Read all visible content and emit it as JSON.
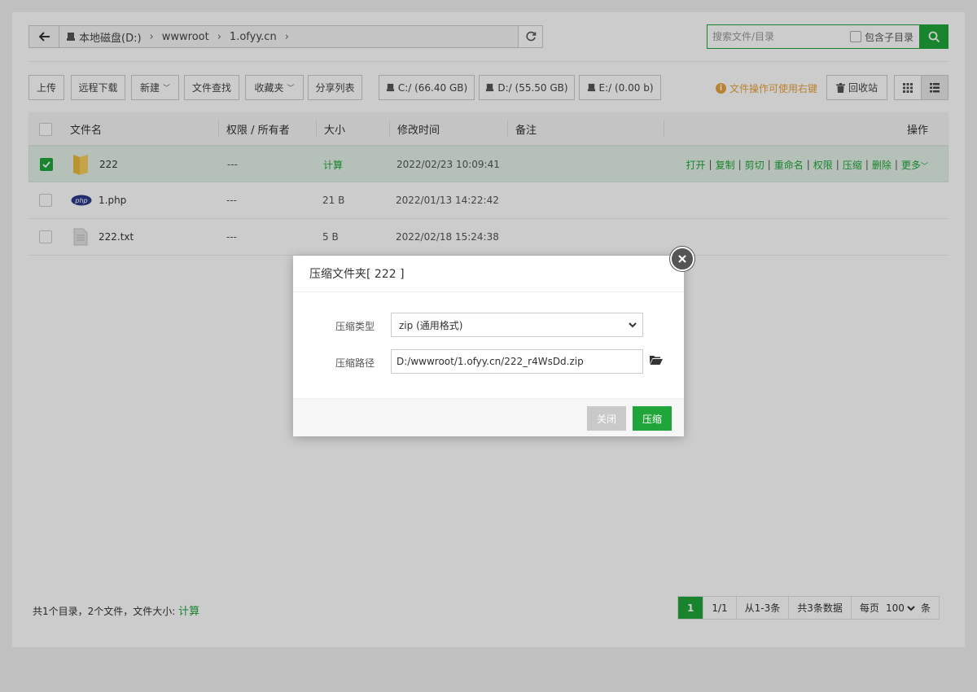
{
  "path": {
    "drive_label": "本地磁盘(D:)",
    "crumbs": [
      "wwwroot",
      "1.ofyy.cn"
    ]
  },
  "search": {
    "placeholder": "搜索文件/目录",
    "include_sub_label": "包含子目录"
  },
  "toolbar": {
    "upload": "上传",
    "remote_download": "远程下载",
    "new": "新建",
    "find": "文件查找",
    "favorites": "收藏夹",
    "share_list": "分享列表",
    "drives": [
      {
        "label": "C:/ (66.40 GB)"
      },
      {
        "label": "D:/ (55.50 GB)"
      },
      {
        "label": "E:/ (0.00 b)"
      }
    ],
    "tip": "文件操作可使用右键",
    "recycle": "回收站"
  },
  "table": {
    "headers": {
      "name": "文件名",
      "perm_owner": "权限 / 所有者",
      "size": "大小",
      "mtime": "修改时间",
      "remark": "备注",
      "ops": "操作"
    },
    "rows": [
      {
        "name": "222",
        "perm": "---",
        "size": "计算",
        "mtime": "2022/02/23 10:09:41",
        "type": "folder",
        "checked": true
      },
      {
        "name": "1.php",
        "perm": "---",
        "size": "21 B",
        "mtime": "2022/01/13 14:22:42",
        "type": "php",
        "checked": false
      },
      {
        "name": "222.txt",
        "perm": "---",
        "size": "5 B",
        "mtime": "2022/02/18 15:24:38",
        "type": "txt",
        "checked": false
      }
    ],
    "row_ops": [
      "打开",
      "复制",
      "剪切",
      "重命名",
      "权限",
      "压缩",
      "删除",
      "更多"
    ]
  },
  "footer": {
    "summary": "共1个目录，2个文件，文件大小:",
    "calc_link": "计算",
    "pager": {
      "current": "1",
      "pages": "1/1",
      "range": "从1-3条",
      "total": "共3条数据",
      "per_page_label": "每页",
      "per_page_value": "100",
      "per_page_suffix": "条"
    }
  },
  "modal": {
    "title": "压缩文件夹[ 222 ]",
    "type_label": "压缩类型",
    "type_value": "zip (通用格式)",
    "path_label": "压缩路径",
    "path_value": "D:/wwwroot/1.ofyy.cn/222_r4WsDd.zip",
    "close_button": "关闭",
    "confirm_button": "压缩"
  },
  "colors": {
    "accent": "#20a53a",
    "tip": "#e8a33a",
    "selected_row": "#e3f1e6"
  }
}
